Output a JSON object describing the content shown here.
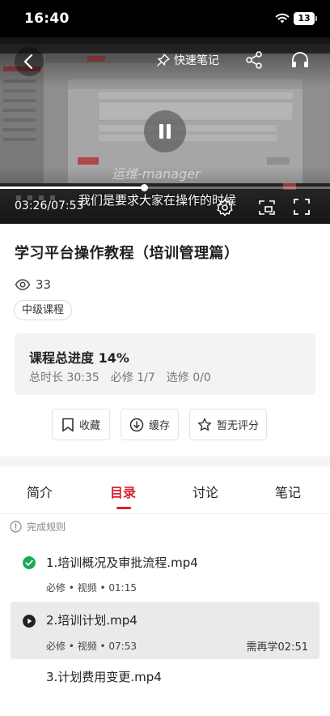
{
  "status_bar": {
    "time": "16:40",
    "battery": "13"
  },
  "video": {
    "quick_notes_label": "快速笔记",
    "time": "03:26/07:53",
    "progress": 0.436,
    "watermark": "运维-manager",
    "subtitle": "我们是要求大家在操作的时候"
  },
  "course": {
    "title": "学习平台操作教程（培训管理篇）",
    "views": "33",
    "level": "中级课程"
  },
  "progress_card": {
    "title": "课程总进度 14%",
    "total_duration": "总时长 30:35",
    "required": "必修 1/7",
    "elective": "选修 0/0"
  },
  "actions": {
    "collect": "收藏",
    "cache": "缓存",
    "rate": "暂无评分"
  },
  "tabs": [
    {
      "label": "简介"
    },
    {
      "label": "目录"
    },
    {
      "label": "讨论"
    },
    {
      "label": "笔记"
    }
  ],
  "completion_rules": "完成规则",
  "lessons": [
    {
      "title": "1.培训概况及审批流程.mp4",
      "meta": "必修 • 视频 • 01:15",
      "status": "done",
      "remaining": ""
    },
    {
      "title": "2.培训计划.mp4",
      "meta": "必修 • 视频 • 07:53",
      "status": "playing",
      "remaining": "需再学02:51"
    },
    {
      "title": "3.计划费用变更.mp4",
      "meta": "",
      "status": "none",
      "remaining": ""
    }
  ],
  "colors": {
    "accent": "#d6232b",
    "done": "#1aaa55"
  }
}
